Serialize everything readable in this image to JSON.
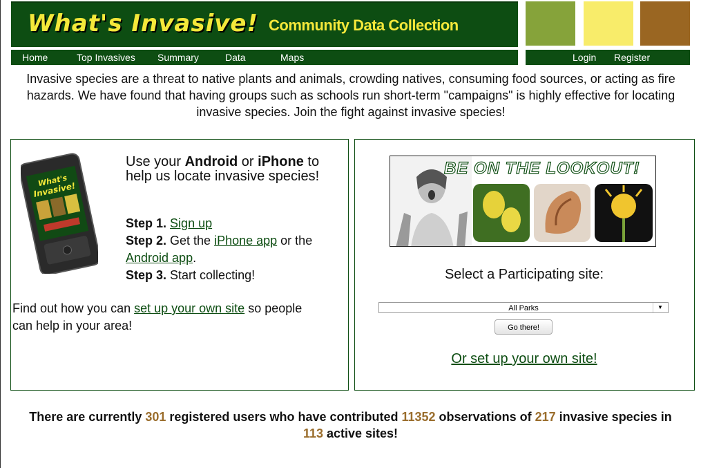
{
  "header": {
    "logo": "What's Invasive!",
    "tagline": "Community Data Collection",
    "swatches": [
      "#86a33a",
      "#f8ec6a",
      "#9a6622"
    ]
  },
  "nav": {
    "left": [
      "Home",
      "Top Invasives",
      "Summary",
      "Data",
      "Maps"
    ],
    "right": [
      "Login",
      "Register"
    ]
  },
  "intro": "Invasive species are a threat to native plants and animals, crowding natives, consuming food sources, or acting as fire hazards. We have found that having groups such as schools run short-term \"campaigns\" is highly effective for locating invasive species. Join the fight against invasive species!",
  "left_panel": {
    "use_prefix": "Use your ",
    "android": "Android",
    "or": " or ",
    "iphone": "iPhone",
    "use_suffix": " to help us locate invasive species!",
    "step1_label": "Step 1.",
    "step1_link": "Sign up",
    "step2_label": "Step 2.",
    "step2_text": " Get the ",
    "step2_link1": "iPhone app",
    "step2_mid": " or the ",
    "step2_link2": "Android app",
    "step2_end": ".",
    "step3_label": "Step 3.",
    "step3_text": " Start collecting!",
    "find_prefix": "Find out how you can ",
    "find_link": "set up your own site",
    "find_suffix": " so people can help in your area!",
    "phone_logo": "What's Invasive!"
  },
  "right_panel": {
    "banner_title": "BE ON THE LOOKOUT!",
    "select_label": "Select a Participating site:",
    "select_value": "All Parks",
    "go_button": "Go there!",
    "own_site_link": "Or set up your own site!"
  },
  "stats": {
    "t1": "There are currently ",
    "users": "301",
    "t2": " registered users who have contributed ",
    "observations": "11352",
    "t3": " observations of ",
    "species": "217",
    "t4": " invasive species in ",
    "sites": "113",
    "t5": " active sites!"
  }
}
